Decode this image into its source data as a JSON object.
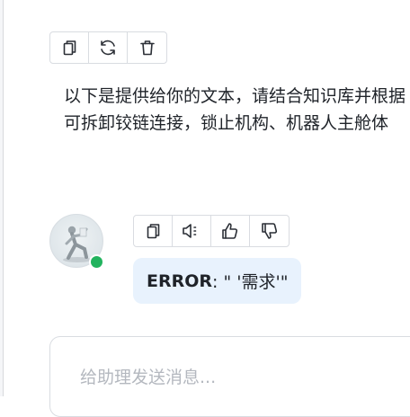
{
  "message": {
    "line1": "以下是提供给你的文本，请结合知识库并根据",
    "line2": "可拆卸铰链连接，锁止机构、机器人主舱体"
  },
  "message_actions": [
    {
      "icon": "copy-icon"
    },
    {
      "icon": "refresh-icon"
    },
    {
      "icon": "trash-icon"
    }
  ],
  "reply_actions": [
    {
      "icon": "copy-icon"
    },
    {
      "icon": "speaker-icon"
    },
    {
      "icon": "thumbs-up-icon"
    },
    {
      "icon": "thumbs-down-icon"
    }
  ],
  "reply": {
    "error_label": "ERROR",
    "error_text": ": \" '需求'\""
  },
  "composer": {
    "placeholder": "给助理发送消息..."
  },
  "colors": {
    "online": "#22b35e",
    "bubble": "#e8f2fd"
  }
}
